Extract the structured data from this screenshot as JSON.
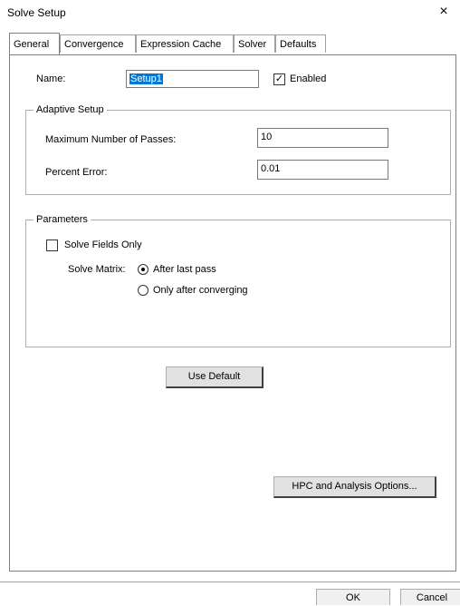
{
  "window": {
    "title": "Solve Setup",
    "close_glyph": "×"
  },
  "tabs": [
    {
      "label": "General",
      "active": true
    },
    {
      "label": "Convergence",
      "active": false
    },
    {
      "label": "Expression Cache",
      "active": false
    },
    {
      "label": "Solver",
      "active": false
    },
    {
      "label": "Defaults",
      "active": false
    }
  ],
  "general": {
    "name_label": "Name:",
    "name_value": "Setup1",
    "enabled_label": "Enabled",
    "enabled_checked": true
  },
  "adaptive": {
    "title": "Adaptive Setup",
    "max_passes_label": "Maximum Number of Passes:",
    "max_passes_value": "10",
    "percent_error_label": "Percent Error:",
    "percent_error_value": "0.01"
  },
  "parameters": {
    "title": "Parameters",
    "solve_fields_only_label": "Solve Fields Only",
    "solve_fields_only_checked": false,
    "solve_matrix_label": "Solve Matrix:",
    "options": [
      {
        "label": "After last pass",
        "selected": true
      },
      {
        "label": "Only after converging",
        "selected": false
      }
    ]
  },
  "buttons": {
    "use_default": "Use Default",
    "hpc": "HPC and Analysis Options...",
    "ok": "OK",
    "cancel": "Cancel"
  }
}
